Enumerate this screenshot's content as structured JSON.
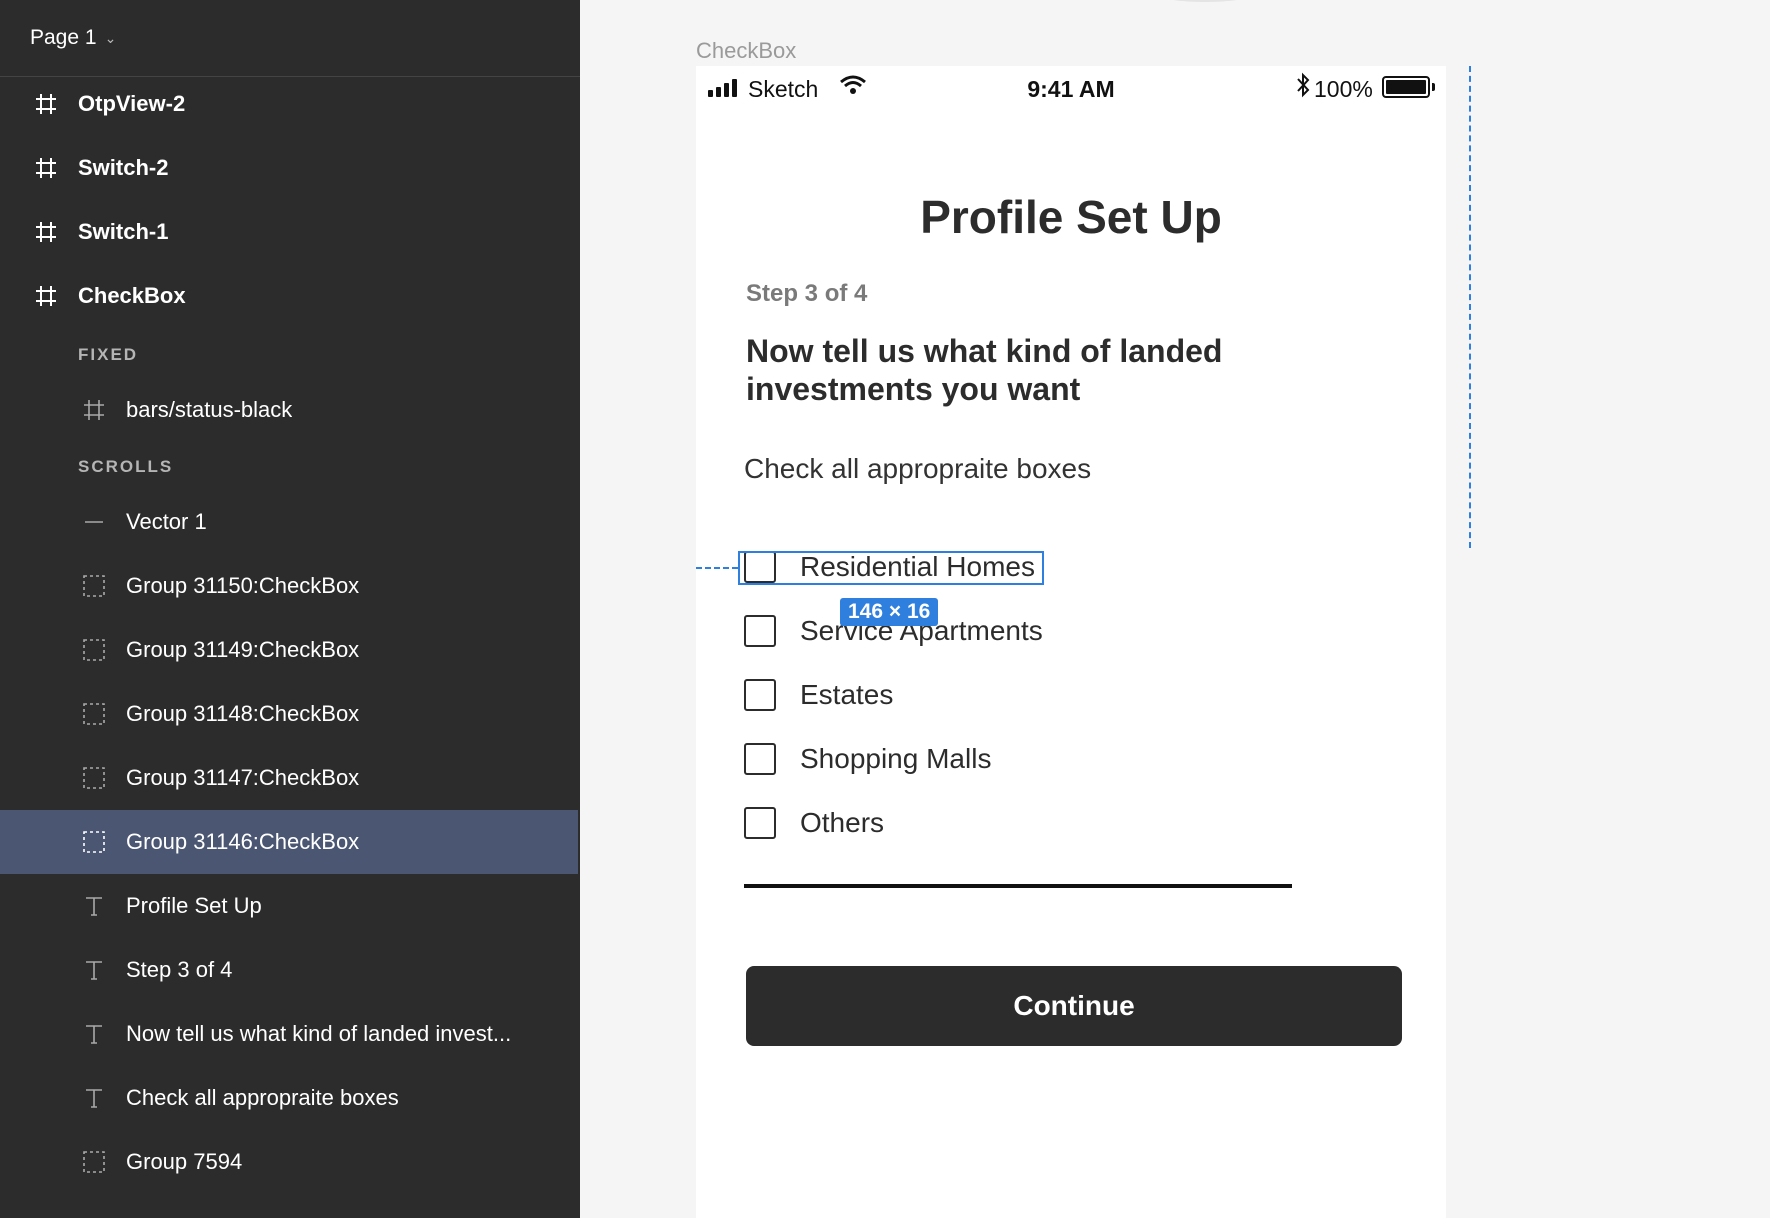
{
  "sidebar": {
    "page_title": "Page 1",
    "frames": [
      {
        "label": "OtpView-2"
      },
      {
        "label": "Switch-2"
      },
      {
        "label": "Switch-1"
      },
      {
        "label": "CheckBox"
      }
    ],
    "section_fixed": "FIXED",
    "fixed_layers": [
      {
        "label": "bars/status-black",
        "icon": "frame-icon"
      }
    ],
    "section_scrolls": "SCROLLS",
    "scroll_layers": [
      {
        "label": "Vector 1",
        "icon": "vector-line-icon"
      },
      {
        "label": "Group 31150:CheckBox",
        "icon": "group-icon"
      },
      {
        "label": "Group 31149:CheckBox",
        "icon": "group-icon"
      },
      {
        "label": "Group 31148:CheckBox",
        "icon": "group-icon"
      },
      {
        "label": "Group 31147:CheckBox",
        "icon": "group-icon"
      },
      {
        "label": "Group 31146:CheckBox",
        "icon": "group-icon",
        "selected": true
      },
      {
        "label": "Profile Set Up",
        "icon": "text-icon"
      },
      {
        "label": "Step 3 of 4",
        "icon": "text-icon"
      },
      {
        "label": "Now tell us what kind of landed invest...",
        "icon": "text-icon"
      },
      {
        "label": "Check all appropraite boxes",
        "icon": "text-icon"
      },
      {
        "label": "Group 7594",
        "icon": "group-icon"
      }
    ]
  },
  "canvas": {
    "frame_label": "CheckBox",
    "status_bar": {
      "carrier": "Sketch",
      "time": "9:41 AM",
      "bluetooth_icon": "bluetooth-icon",
      "battery": "100%"
    },
    "screen": {
      "title": "Profile Set Up",
      "step": "Step 3 of 4",
      "question": "Now tell us what kind of landed investments you want",
      "hint": "Check all appropraite boxes",
      "options": [
        {
          "label": "Residential Homes",
          "checked": false
        },
        {
          "label": "Service Apartments",
          "checked": false
        },
        {
          "label": "Estates",
          "checked": false
        },
        {
          "label": "Shopping Malls",
          "checked": false
        },
        {
          "label": "Others",
          "checked": false
        }
      ],
      "continue_label": "Continue"
    },
    "selection": {
      "dimensions_label": "146 × 16",
      "color": "#2f7fde"
    }
  }
}
